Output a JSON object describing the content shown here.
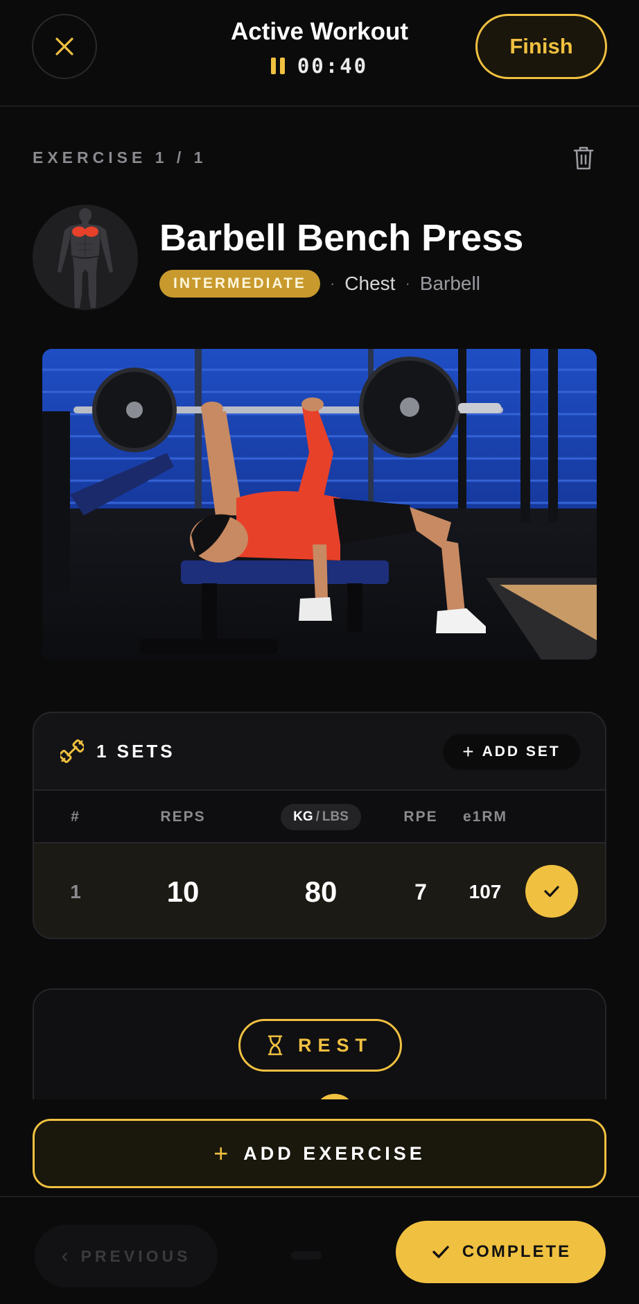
{
  "header": {
    "title": "Active Workout",
    "timer": "00:40",
    "finish_label": "Finish"
  },
  "exercise": {
    "counter": "EXERCISE 1 / 1",
    "name": "Barbell Bench Press",
    "level": "INTERMEDIATE",
    "muscle": "Chest",
    "equipment": "Barbell"
  },
  "sets": {
    "title": "1 SETS",
    "add_set_label": "ADD SET",
    "columns": {
      "index": "#",
      "reps": "REPS",
      "unit_active": "KG",
      "unit_separator": "/",
      "unit_inactive": "LBS",
      "rpe": "RPE",
      "e1rm": "e1RM"
    },
    "rows": [
      {
        "index": "1",
        "reps": "10",
        "weight": "80",
        "rpe": "7",
        "e1rm": "107",
        "completed": true
      }
    ]
  },
  "rest": {
    "label": "REST"
  },
  "add_exercise_label": "ADD EXERCISE",
  "footer": {
    "previous_label": "PREVIOUS",
    "complete_label": "COMPLETE"
  },
  "colors": {
    "accent": "#f0c040",
    "badge": "#c89a2e",
    "background": "#0b0b0c",
    "card": "#141416",
    "muscle_highlight": "#e8412a"
  },
  "icons": [
    "close-icon",
    "pause-icon",
    "trash-icon",
    "dumbbell-icon",
    "plus-icon",
    "check-icon",
    "hourglass-icon",
    "chevron-left-icon"
  ]
}
